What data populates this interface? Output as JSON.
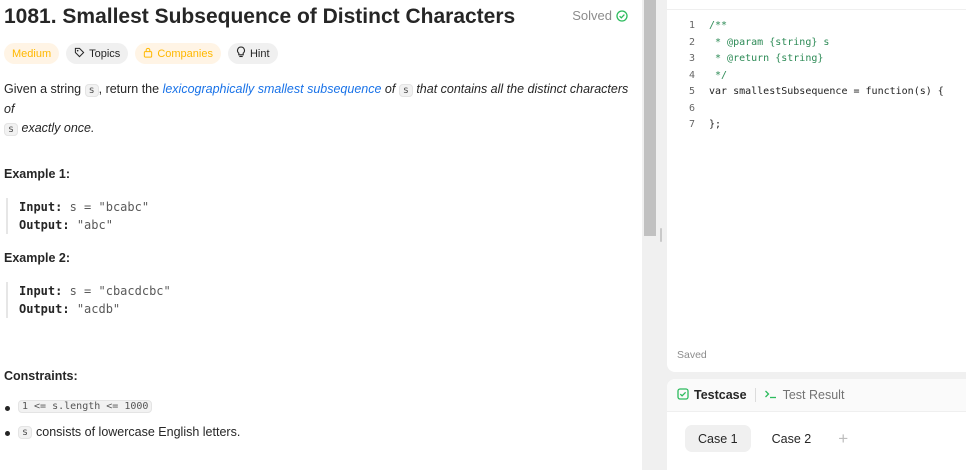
{
  "problem": {
    "title": "1081. Smallest Subsequence of Distinct Characters",
    "status": "Solved",
    "tags": {
      "difficulty": "Medium",
      "topics": "Topics",
      "companies": "Companies",
      "hint": "Hint"
    },
    "description": {
      "p1": "Given a string ",
      "code_s": "s",
      "p2": ", return the ",
      "link": "lexicographically smallest subsequence",
      "p3": " of ",
      "p4": " that contains all the distinct characters of",
      "p5": " exactly once."
    },
    "examples": [
      {
        "heading": "Example 1:",
        "input_label": "Input:",
        "input_value": "s = \"bcabc\"",
        "output_label": "Output:",
        "output_value": "\"abc\""
      },
      {
        "heading": "Example 2:",
        "input_label": "Input:",
        "input_value": "s = \"cbacdcbc\"",
        "output_label": "Output:",
        "output_value": "\"acdb\""
      }
    ],
    "constraints_heading": "Constraints:",
    "constraints": [
      {
        "code": "1 <= s.length <= 1000",
        "text": ""
      },
      {
        "code": "s",
        "text": "consists of lowercase English letters."
      }
    ]
  },
  "editor": {
    "lines": [
      {
        "n": "1",
        "text": "/**"
      },
      {
        "n": "2",
        "text": " * @param {string} s"
      },
      {
        "n": "3",
        "text": " * @return {string}"
      },
      {
        "n": "4",
        "text": " */"
      },
      {
        "n": "5",
        "text": "var smallestSubsequence = function(s) {"
      },
      {
        "n": "6",
        "text": ""
      },
      {
        "n": "7",
        "text": "};"
      }
    ],
    "saved_label": "Saved"
  },
  "testpanel": {
    "tab_testcase": "Testcase",
    "tab_result": "Test Result",
    "cases": [
      "Case 1",
      "Case 2"
    ],
    "add_symbol": "+"
  },
  "colors": {
    "accent_green": "#2cbb5d",
    "medium": "#ffb800",
    "link": "#1a73e8"
  }
}
